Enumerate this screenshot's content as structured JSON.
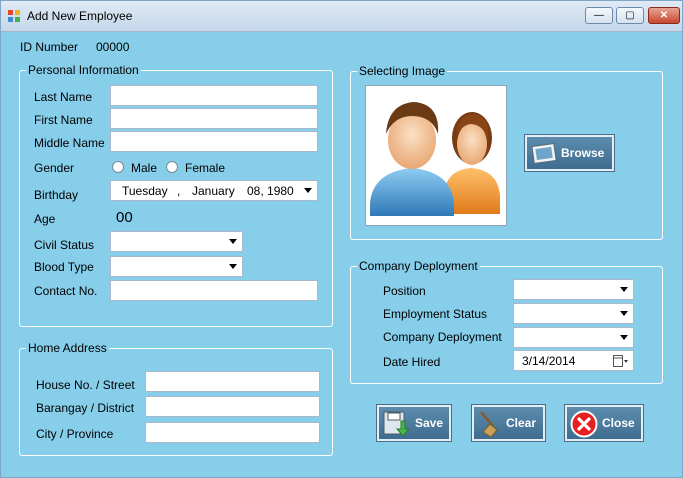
{
  "window": {
    "title": "Add New Employee",
    "minimize": "—",
    "maximize": "▢",
    "close": "✕"
  },
  "id": {
    "label": "ID Number",
    "value": "00000"
  },
  "personal": {
    "title": "Personal Information",
    "last_name": "Last Name",
    "first_name": "First Name",
    "middle_name": "Middle Name",
    "gender": "Gender",
    "male": "Male",
    "female": "Female",
    "birthday": "Birthday",
    "birthday_day": "Tuesday",
    "birthday_sep": ",",
    "birthday_month": "January",
    "birthday_date": "08, 1980",
    "age": "Age",
    "age_value": "00",
    "civil_status": "Civil Status",
    "blood_type": "Blood Type",
    "contact": "Contact No."
  },
  "image": {
    "title": "Selecting Image",
    "browse": "Browse"
  },
  "address": {
    "title": "Home Address",
    "house": "House No. / Street",
    "barangay": "Barangay / District",
    "city": "City / Province"
  },
  "deployment": {
    "title": "Company Deployment",
    "position": "Position",
    "employment_status": "Employment Status",
    "company_deployment": "Company Deployment",
    "date_hired": "Date Hired",
    "date_hired_value": "3/14/2014"
  },
  "actions": {
    "save": "Save",
    "clear": "Clear",
    "close": "Close"
  },
  "colors": {
    "background": "#87CEEB",
    "button": "#4f7d9e"
  }
}
